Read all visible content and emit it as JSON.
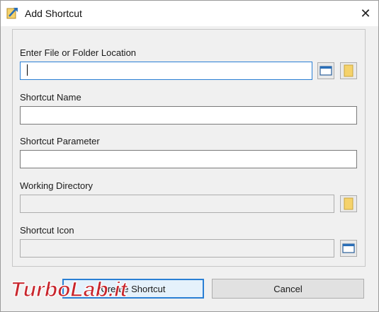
{
  "window": {
    "title": "Add Shortcut",
    "close_glyph": "✕"
  },
  "fields": {
    "location": {
      "label": "Enter File or Folder Location",
      "value": ""
    },
    "name": {
      "label": "Shortcut Name",
      "value": ""
    },
    "parameter": {
      "label": "Shortcut Parameter",
      "value": ""
    },
    "working_dir": {
      "label": "Working Directory",
      "value": ""
    },
    "icon": {
      "label": "Shortcut Icon",
      "value": ""
    }
  },
  "buttons": {
    "create": "Create Shortcut",
    "cancel": "Cancel"
  },
  "watermark": {
    "text": "TurboLab.it"
  },
  "icons": {
    "app": "shortcut-arrow-icon",
    "window": "window-icon",
    "folder": "folder-icon"
  },
  "colors": {
    "accent": "#2a7fd4",
    "folder": "#f5d26b",
    "watermark": "#c8262d"
  }
}
